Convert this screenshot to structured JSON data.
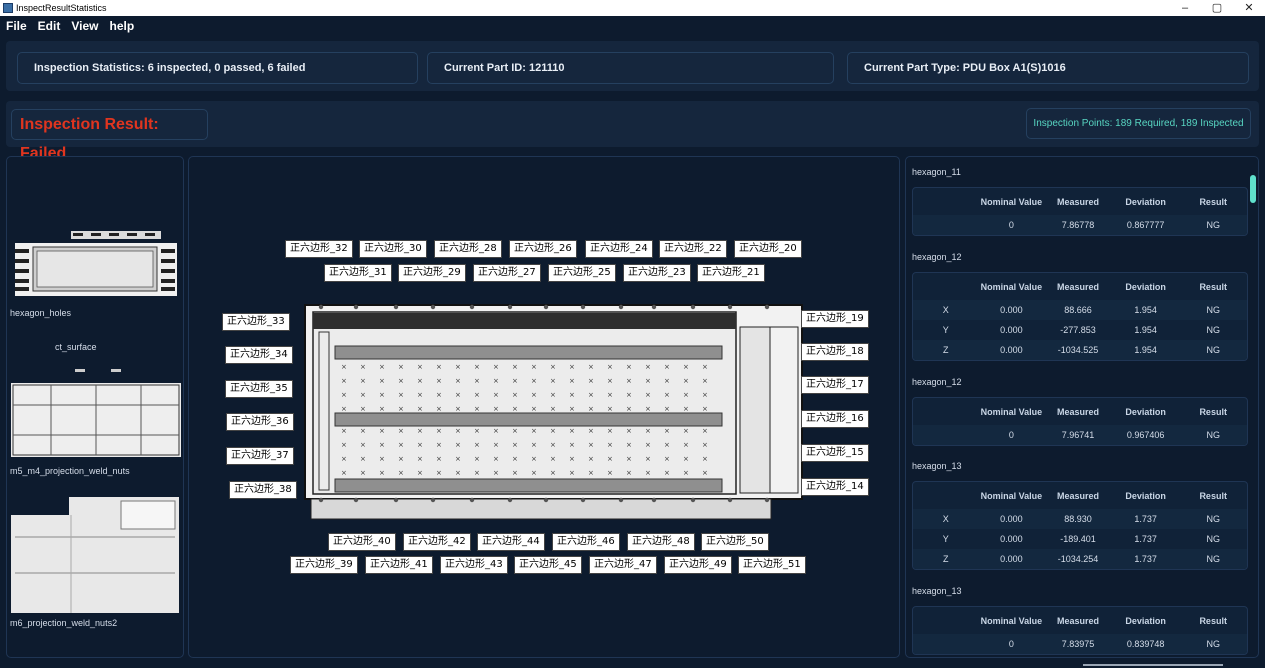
{
  "window": {
    "title": "InspectResultStatistics",
    "minimize": "–",
    "maximize": "▢",
    "close": "✕"
  },
  "menu": [
    "File",
    "Edit",
    "View",
    "help"
  ],
  "stats": {
    "inspection": "Inspection Statistics: 6 inspected, 0 passed, 6 failed",
    "part_id": "Current Part ID: 121110",
    "part_type": "Current Part Type: PDU Box A1(S)1016"
  },
  "result": {
    "status": "Inspection Result: Failed",
    "status_color": "#e0351f",
    "points": "Inspection Points: 189 Required, 189 Inspected",
    "points_color": "#58d6c2"
  },
  "thumbnails": [
    {
      "label": "hexagon_holes",
      "icon": "part-thumbnail-icon"
    },
    {
      "label": "m5_m4_projection_weld_nuts",
      "caption_top": "ct_surface",
      "icon": "part-thumbnail-icon"
    },
    {
      "label": "m6_projection_weld_nuts2",
      "icon": "part-thumbnail-icon"
    }
  ],
  "callouts": {
    "top_row1": [
      "正六边形_32",
      "正六边形_30",
      "正六边形_28",
      "正六边形_26",
      "正六边形_24",
      "正六边形_22",
      "正六边形_20"
    ],
    "top_row2": [
      "正六边形_31",
      "正六边形_29",
      "正六边形_27",
      "正六边形_25",
      "正六边形_23",
      "正六边形_21"
    ],
    "left": [
      "正六边形_33",
      "正六边形_34",
      "正六边形_35",
      "正六边形_36",
      "正六边形_37",
      "正六边形_38"
    ],
    "right": [
      "正六边形_19",
      "正六边形_18",
      "正六边形_17",
      "正六边形_16",
      "正六边形_15",
      "正六边形_14"
    ],
    "bottom_row1": [
      "正六边形_40",
      "正六边形_42",
      "正六边形_44",
      "正六边形_46",
      "正六边形_48",
      "正六边形_50"
    ],
    "bottom_row2": [
      "正六边形_39",
      "正六边形_41",
      "正六边形_43",
      "正六边形_45",
      "正六边形_47",
      "正六边形_49",
      "正六边形_51"
    ]
  },
  "table_headers": [
    "",
    "Nominal Value",
    "Measured",
    "Deviation",
    "Result"
  ],
  "measurements": [
    {
      "title": "hexagon_11",
      "rows": [
        [
          "",
          "0",
          "7.86778",
          "0.867777",
          "NG"
        ]
      ]
    },
    {
      "title": "hexagon_12",
      "rows": [
        [
          "X",
          "0.000",
          "88.666",
          "1.954",
          "NG"
        ],
        [
          "Y",
          "0.000",
          "-277.853",
          "1.954",
          "NG"
        ],
        [
          "Z",
          "0.000",
          "-1034.525",
          "1.954",
          "NG"
        ]
      ]
    },
    {
      "title": "hexagon_12",
      "rows": [
        [
          "",
          "0",
          "7.96741",
          "0.967406",
          "NG"
        ]
      ]
    },
    {
      "title": "hexagon_13",
      "rows": [
        [
          "X",
          "0.000",
          "88.930",
          "1.737",
          "NG"
        ],
        [
          "Y",
          "0.000",
          "-189.401",
          "1.737",
          "NG"
        ],
        [
          "Z",
          "0.000",
          "-1034.254",
          "1.737",
          "NG"
        ]
      ]
    },
    {
      "title": "hexagon_13",
      "rows": [
        [
          "",
          "0",
          "7.83975",
          "0.839748",
          "NG"
        ]
      ]
    }
  ]
}
